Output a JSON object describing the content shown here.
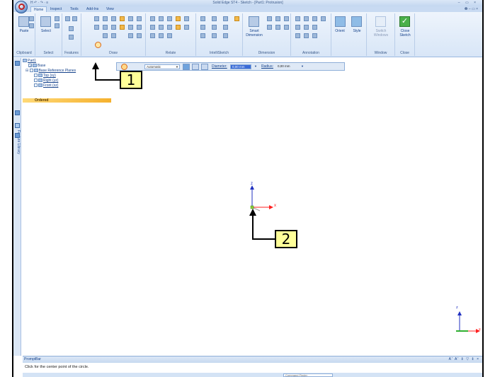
{
  "window": {
    "title": "Solid Edge ST4 - Sketch - [Part1: Protrusion]",
    "qat": "H  ↶ ·  ↷ ·  ≡",
    "controls": "–  ▭  ×",
    "help_controls": "❷ – ▭ ×"
  },
  "tabs": [
    {
      "label": "Home"
    },
    {
      "label": "Inspect"
    },
    {
      "label": "Tools"
    },
    {
      "label": "Add-Ins"
    },
    {
      "label": "View"
    }
  ],
  "ribbon": {
    "groups": [
      {
        "label": "Clipboard"
      },
      {
        "label": "Select"
      },
      {
        "label": "Features"
      },
      {
        "label": "Draw"
      },
      {
        "label": "Relate"
      },
      {
        "label": "IntelliSketch"
      },
      {
        "label": "Dimension"
      },
      {
        "label": "Annotation"
      },
      {
        "label": "Window"
      },
      {
        "label": "Close"
      }
    ],
    "paste_label": "Paste",
    "select_label": "Select",
    "smart_dimension_label": "Smart Dimension",
    "orient_label": "Orient",
    "style_label": "Style",
    "switch_windows_label": "Switch Windows",
    "close_sketch_label": "Close Sketch"
  },
  "command_bar": {
    "mode_value": "Automatic",
    "diameter_label": "Diameter:",
    "diameter_value": "0,00 mm",
    "radius_label": "Radius:",
    "radius_value": "0,00 mm"
  },
  "side_tab": {
    "label": "Feature Library"
  },
  "tree": {
    "part": "Part1",
    "base": "Base",
    "ref_planes": "Base Reference Planes",
    "planes": [
      "Top (xy)",
      "Right (yz)",
      "Front (xz)"
    ],
    "ordered": "Ordered"
  },
  "callouts": [
    "1",
    "2"
  ],
  "axes": {
    "x": "x",
    "z": "z"
  },
  "prompt": {
    "title": "PromptBar",
    "controls": "A' A' ⇕ ▽ ⇕ ×",
    "message": "Click for the center point of the circle.",
    "command_finder": "Command Finder"
  },
  "colors": {
    "ribbon_bg": "#dfe9f7",
    "callout_fill": "#ffff99",
    "axis_x": "#ff2020",
    "axis_y": "#30b030",
    "axis_z": "#2030c0"
  }
}
